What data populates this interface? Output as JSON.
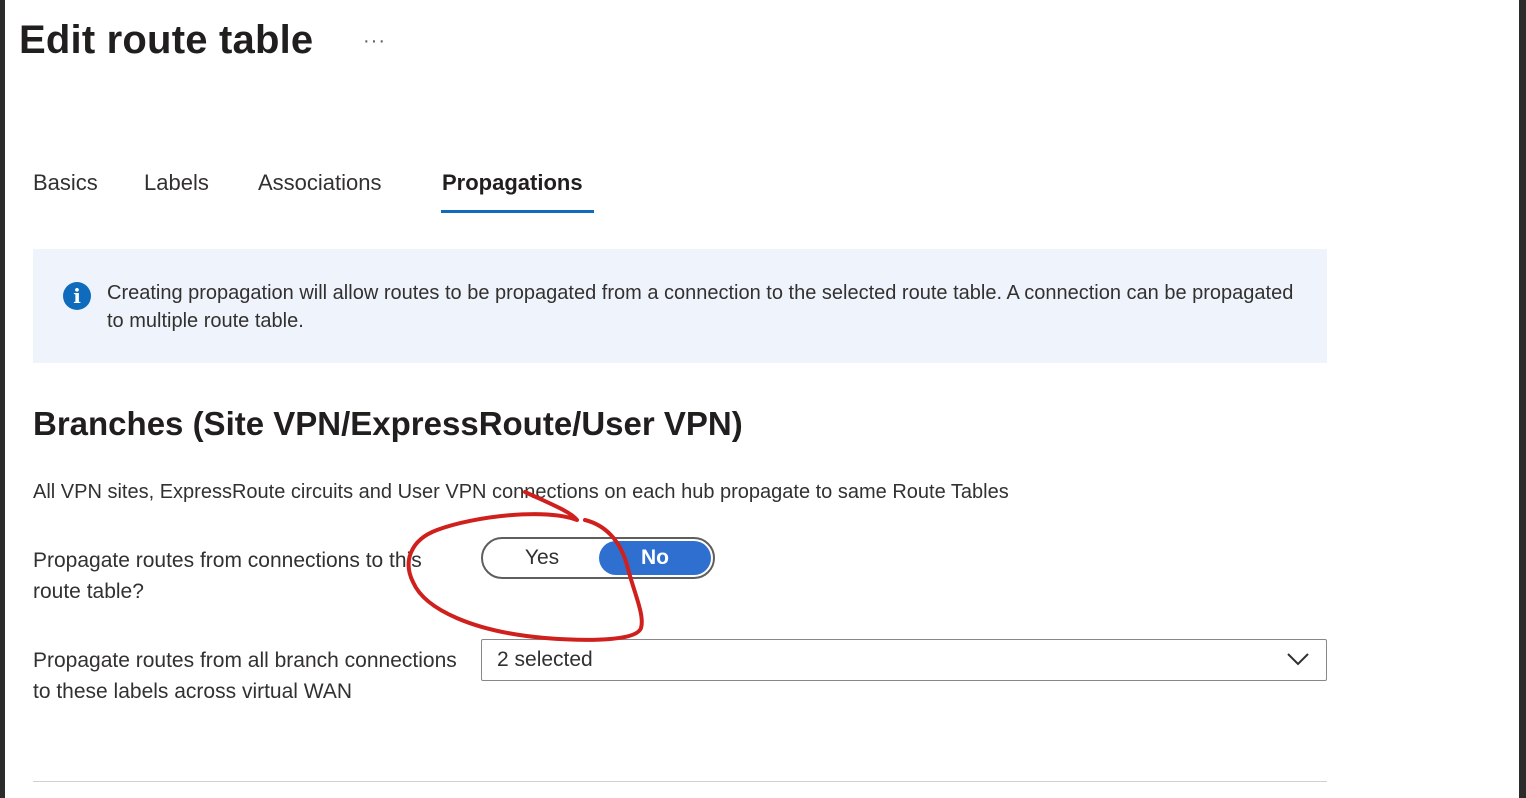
{
  "page": {
    "title": "Edit route table",
    "more_label": "···"
  },
  "tabs": [
    {
      "label": "Basics",
      "active": false
    },
    {
      "label": "Labels",
      "active": false
    },
    {
      "label": "Associations",
      "active": false
    },
    {
      "label": "Propagations",
      "active": true
    }
  ],
  "info": {
    "icon": "info-icon",
    "icon_glyph": "i",
    "text": "Creating propagation will allow routes to be propagated from a connection to the selected route table. A connection can be propagated to multiple route table."
  },
  "branches": {
    "heading": "Branches (Site VPN/ExpressRoute/User VPN)",
    "description": "All VPN sites, ExpressRoute circuits and User VPN connections on each hub propagate to same Route Tables",
    "propagate_label": "Propagate routes from connections to this route table?",
    "toggle": {
      "yes_label": "Yes",
      "no_label": "No",
      "selected": "No"
    },
    "labels_label": "Propagate routes from all branch connections to these labels across virtual WAN",
    "labels_value": "2 selected"
  },
  "colors": {
    "accent": "#0f6cbd",
    "toggle_on": "#2f6fd0",
    "info_bg": "#eff4fc",
    "annotation": "#d0201d"
  }
}
